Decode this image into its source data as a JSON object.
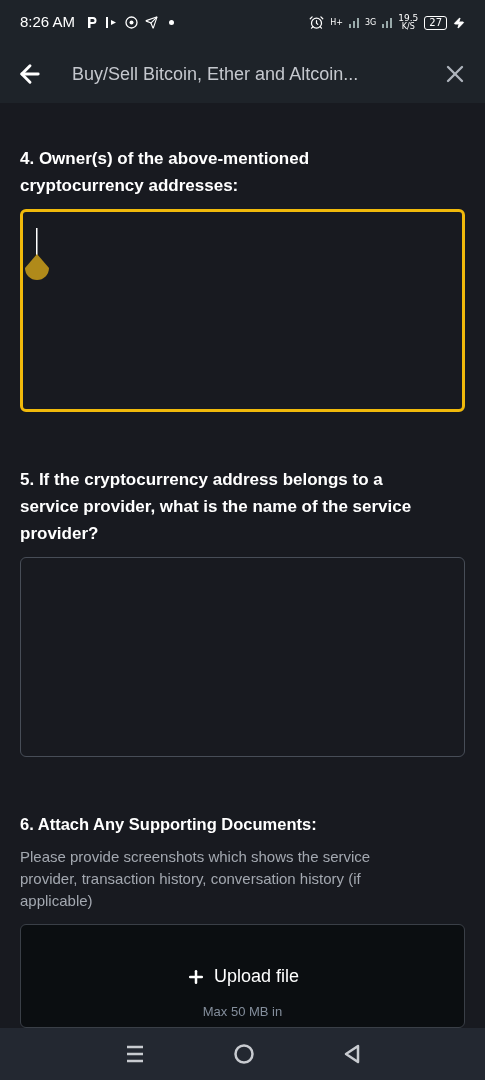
{
  "status_bar": {
    "time": "8:26 AM",
    "network_1": "H+",
    "network_2": "3G",
    "speed": "19.5",
    "speed_unit": "K/S",
    "battery": "27"
  },
  "header": {
    "title": "Buy/Sell Bitcoin, Ether and Altcoin..."
  },
  "questions": [
    {
      "label": "4. Owner(s) of the above-mentioned cryptocurrency addresses:",
      "focused": true
    },
    {
      "label": "5. If the cryptocurrency address belongs to a service provider, what is the name of the service provider?",
      "focused": false
    }
  ],
  "attachment": {
    "label": "6. Attach Any Supporting Documents:",
    "description": "Please provide screenshots which shows the service provider, transaction history, conversation history (if applicable)",
    "button": "Upload file",
    "hint": "Max 50 MB in"
  }
}
